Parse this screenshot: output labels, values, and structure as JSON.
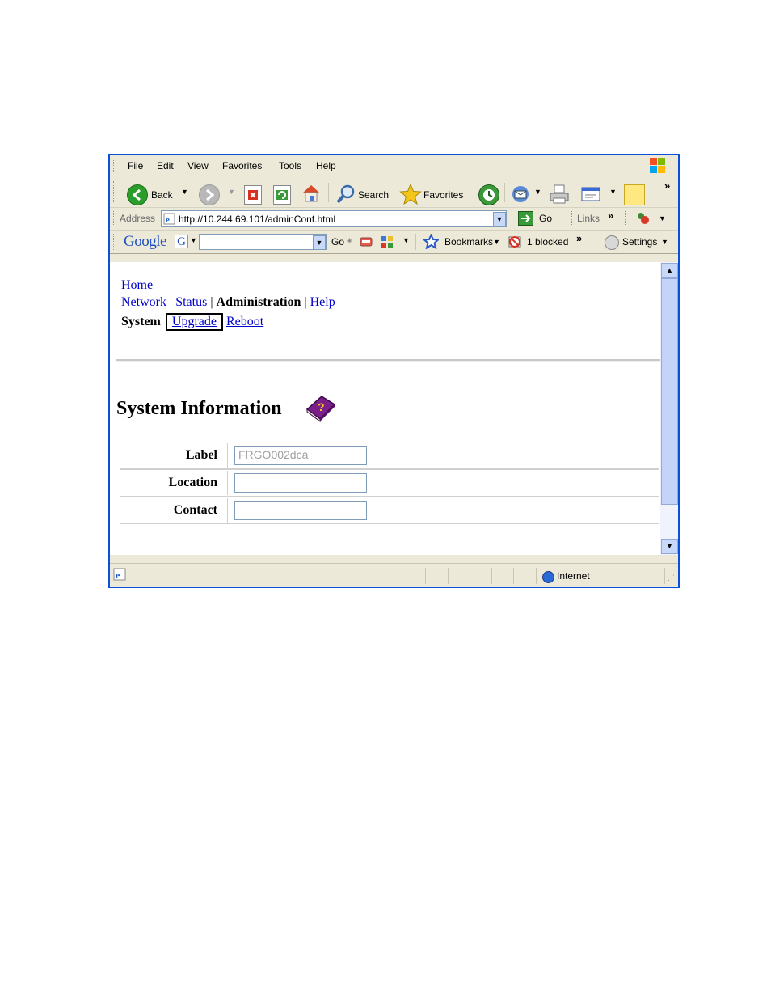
{
  "menu": [
    "File",
    "Edit",
    "View",
    "Favorites",
    "Tools",
    "Help"
  ],
  "toolbar": {
    "back": "Back",
    "search": "Search",
    "favorites": "Favorites",
    "overflow": "»"
  },
  "address": {
    "label": "Address",
    "url": "http://10.244.69.101/adminConf.html",
    "go": "Go",
    "links": "Links",
    "overflow": "»"
  },
  "google_bar": {
    "logo": "Google",
    "g": "G",
    "go": "Go",
    "bookmarks": "Bookmarks",
    "blocked": "1 blocked",
    "settings": "Settings",
    "overflow": "»"
  },
  "nav": {
    "home": "Home",
    "row2": [
      "Network",
      "Status"
    ],
    "row2_current": "Administration",
    "row2_last": "Help",
    "sep": "|",
    "row3_current": "System",
    "row3_links": [
      "Upgrade",
      "Reboot"
    ]
  },
  "page": {
    "title": "System Information"
  },
  "form": {
    "rows": [
      {
        "label": "Label",
        "value": "FRGO002dca"
      },
      {
        "label": "Location",
        "value": ""
      },
      {
        "label": "Contact",
        "value": ""
      }
    ]
  },
  "status": {
    "zone": "Internet"
  },
  "colors": {
    "titlebar": "#0a50d8",
    "chrome": "#ece9d8",
    "link": "#0000cc",
    "highlight_box": "#000000"
  }
}
